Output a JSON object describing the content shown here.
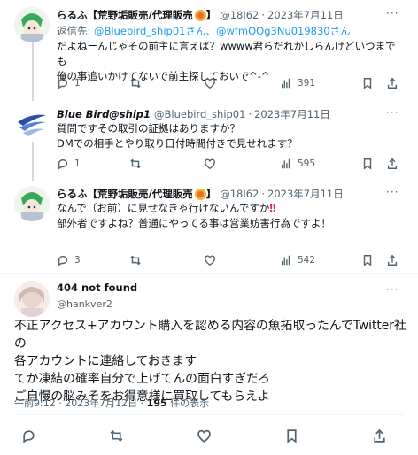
{
  "tweets": [
    {
      "name": "らるふ【荒野垢販売/代理販売",
      "name_suffix": "】",
      "handle": "@18I62",
      "date": "2023年7月11日",
      "reply_prefix": "返信先: ",
      "reply_to": "@Bluebird_ship01さん、@wfmOOg3Nu019830さん",
      "text": "だよねーんじゃその前主に言えば？wwww君らだれかしらんけどいつまでも\n俺の事追いかけてないで前主探しておいで^-^",
      "stats": {
        "reply": "1",
        "retweet": "",
        "like": "",
        "views": "391"
      }
    },
    {
      "name": "Blue Bird@ship1",
      "handle": "@Bluebird_ship01",
      "date": "2023年7月11日",
      "text": "質問ですその取引の証拠はありますか？\nDMでの相手とやり取り日付時間付きで見せれます？",
      "stats": {
        "reply": "1",
        "retweet": "",
        "like": "",
        "views": "595"
      }
    },
    {
      "name": "らるふ【荒野垢販売/代理販売",
      "name_suffix": "】",
      "handle": "@18I62",
      "date": "2023年7月11日",
      "text_line1": "なんで（お前）に見せなきゃ行けないんですか",
      "exclaim": "‼",
      "text_rest": "\n部外者ですよね？普通にやってる事は営業妨害行為ですよ！",
      "stats": {
        "reply": "3",
        "retweet": "",
        "like": "",
        "views": "542"
      }
    }
  ],
  "main": {
    "name": "404 not found",
    "handle": "@hankver2",
    "text": "不正アクセス+アカウント購入を認める内容の魚拓取ったんでTwitter社の\n各アカウントに連絡しておきます\nてか凍結の確率自分で上げてんの面白すぎだろ\nご自慢の脳みそをお得意様に買取してもらえよ",
    "time": "午前9:12 · 2023年7月12日 · ",
    "views_count": "195",
    "views_label": " 件の表示"
  },
  "colors": {
    "link": "#1d9bf0",
    "muted": "#536471",
    "text": "#0f1419",
    "line": "#cfd9de"
  }
}
